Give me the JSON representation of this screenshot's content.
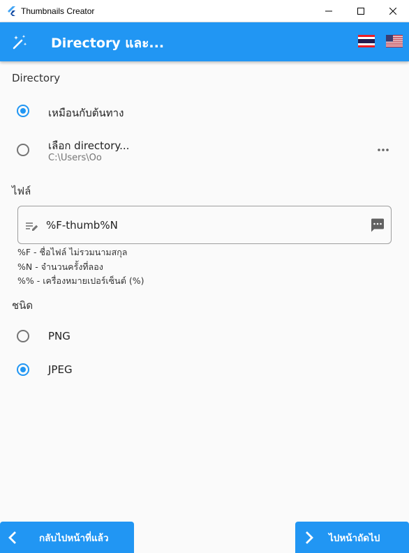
{
  "window": {
    "title": "Thumbnails Creator"
  },
  "appbar": {
    "title": "Directory และ..."
  },
  "directory": {
    "label": "Directory",
    "options": [
      {
        "label": "เหมือนกับต้นทาง",
        "checked": true
      },
      {
        "label": "เลือก directory...",
        "path": "C:\\Users\\Oo",
        "checked": false
      }
    ]
  },
  "file": {
    "label": "ไฟล์",
    "pattern": "%F-thumb%N",
    "help": [
      "%F - ชื่อไฟล์ ไม่รวมนามสกุล",
      "%N - จำนวนครั้งที่ลอง",
      "%% - เครื่องหมายเปอร์เซ็นต์ (%)"
    ]
  },
  "type": {
    "label": "ชนิด",
    "options": [
      {
        "label": "PNG",
        "checked": false
      },
      {
        "label": "JPEG",
        "checked": true
      }
    ]
  },
  "nav": {
    "back_label": "กลับไปหน้าที่แล้ว",
    "next_label": "ไปหน้าถัดไป"
  },
  "colors": {
    "primary": "#2196f3"
  }
}
